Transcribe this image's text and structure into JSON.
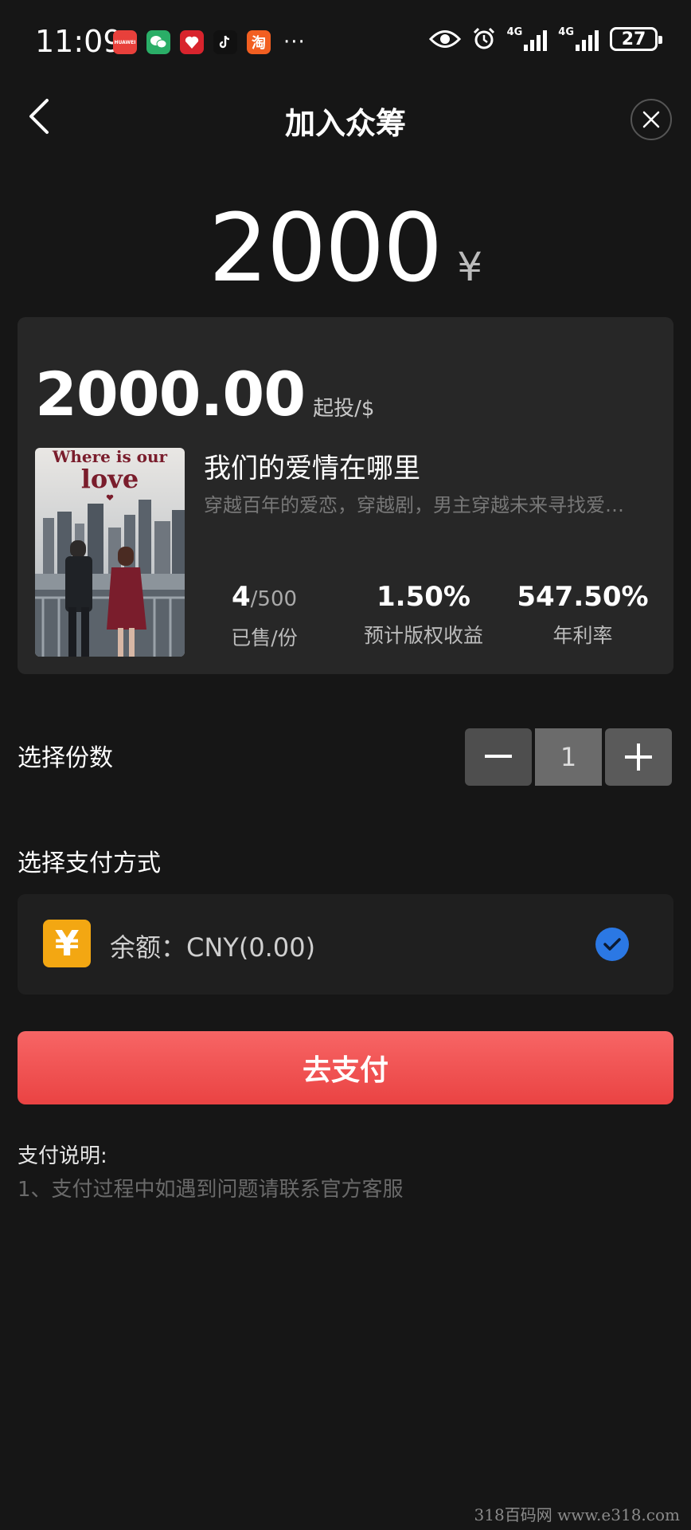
{
  "status_bar": {
    "time": "11:09",
    "apps": [
      {
        "icon": "huawei-appgallery-icon",
        "label": "HUAWEI",
        "color": "#e8403b"
      },
      {
        "icon": "wechat-icon",
        "label": "",
        "color": "#2aae67"
      },
      {
        "icon": "pinduoduo-icon",
        "label": "",
        "color": "#d8242d"
      },
      {
        "icon": "tiktok-icon",
        "label": "",
        "color": "#111111"
      },
      {
        "icon": "taobao-icon",
        "label": "淘",
        "color": "#f25f21"
      }
    ],
    "more": "···",
    "network_1": "4G",
    "network_2": "4G",
    "battery": "27"
  },
  "nav": {
    "title": "加入众筹"
  },
  "amount": {
    "value": "2000",
    "currency": "¥"
  },
  "product": {
    "price": "2000.00",
    "price_unit": "起投/$",
    "cover_title_line1": "Where is our",
    "cover_title_line2": "love",
    "title": "我们的爱情在哪里",
    "description": "穿越百年的爱恋，穿越剧，男主穿越未来寻找爱人的故事",
    "stats": [
      {
        "value": "4",
        "total": "/500",
        "label": "已售/份"
      },
      {
        "value": "1.50%",
        "total": "",
        "label": "预计版权收益"
      },
      {
        "value": "547.50%",
        "total": "",
        "label": "年利率"
      }
    ]
  },
  "quantity": {
    "label": "选择份数",
    "value": "1"
  },
  "payment": {
    "label": "选择支付方式",
    "option_icon": "¥",
    "option_text": "余额：CNY(0.00)",
    "selected": true,
    "accent_color": "#2b78e4"
  },
  "pay_button": {
    "label": "去支付",
    "color": "#ee4a4a"
  },
  "notes": {
    "title": "支付说明:",
    "line1": "1、支付过程中如遇到问题请联系官方客服"
  },
  "watermark": "318百码网  www.e318.com"
}
